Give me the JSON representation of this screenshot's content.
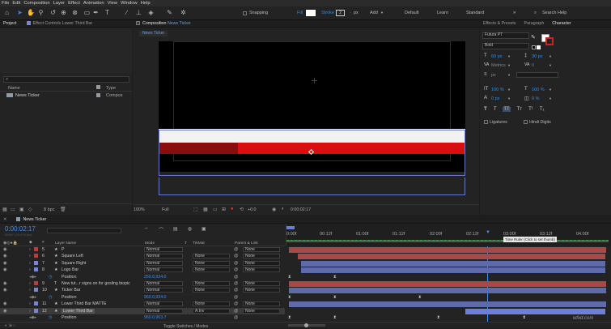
{
  "menu": [
    "File",
    "Edit",
    "Composition",
    "Layer",
    "Effect",
    "Animation",
    "View",
    "Window",
    "Help"
  ],
  "toolbar": {
    "snapping": "Snapping",
    "fill": "Fill",
    "stroke": "Stroke",
    "stroke_value": "2",
    "px": "px",
    "add": "Add",
    "workspaces": [
      "Default",
      "Learn",
      "Standard"
    ],
    "search_placeholder": "Search Help"
  },
  "project_panel": {
    "tab_project": "Project",
    "tab_effect_controls": "Effect Controls",
    "effect_controls_target": "Lower Third Bar",
    "search_glyph": "⌕",
    "col_name": "Name",
    "col_type": "Type",
    "items": [
      {
        "name": "News Ticker",
        "type": "Compos"
      }
    ],
    "bpc": "8 bpc"
  },
  "composition": {
    "tab": "Composition",
    "comp_name": "News Ticker",
    "sub_tab": "News Ticker",
    "zoom": "100%",
    "quality": "Full",
    "exposure": "+0.0",
    "timecode": "0:00:02:17"
  },
  "right_panel": {
    "tabs": [
      "Effects & Presets",
      "Paragraph",
      "Character"
    ],
    "font": "Futura PT",
    "style": "Bold",
    "size": "60 px",
    "leading": "30 px",
    "kerning": "Metrics",
    "tracking": "0",
    "vscale": "100 %",
    "hscale": "100 %",
    "baseline": "0 px",
    "tsume": "0 %",
    "unit": "px",
    "styles": [
      "T",
      "T",
      "TT",
      "Tт",
      "T¹",
      "T₁"
    ],
    "ligatures": "Ligatures",
    "hindi_digits": "Hindi Digits"
  },
  "timeline": {
    "tab": "News Ticker",
    "timecode": "0:00:02:17",
    "timecode_sub": "00067 (23.976 fps)",
    "columns": {
      "layer_name": "Layer Name",
      "mode": "Mode",
      "t": "T",
      "trkmat": "TrkMat",
      "parent": "Parent & Link"
    },
    "ruler": [
      "0:00f",
      "00:12f",
      "01:00f",
      "01:12f",
      "02:00f",
      "02:12f",
      "03:00f",
      "03:12f",
      "04:00f"
    ],
    "tooltip": "Time Ruler (Click to set thumb)",
    "toggle": "Toggle Switches / Modes",
    "layers": [
      {
        "num": "5",
        "name": "P",
        "mode": "Normal",
        "trkmat": "",
        "parent": "None",
        "color": "#c23a3a",
        "star": true
      },
      {
        "num": "6",
        "name": "Square Left",
        "mode": "Normal",
        "trkmat": "None",
        "parent": "None",
        "color": "#c23a3a",
        "star": true
      },
      {
        "num": "7",
        "name": "Square Right",
        "mode": "Normal",
        "trkmat": "None",
        "parent": "None",
        "color": "#7a86c8",
        "star": true
      },
      {
        "num": "8",
        "name": "Logo Bar",
        "mode": "Normal",
        "trkmat": "None",
        "parent": "None",
        "color": "#7a86c8",
        "star": true
      },
      {
        "num": "",
        "name": "Position",
        "value": "250.0,934.0",
        "prop": true
      },
      {
        "num": "9",
        "name": "New tut...r signs on for gosling biopic",
        "mode": "Normal",
        "trkmat": "None",
        "parent": "None",
        "color": "#c23a3a",
        "star": false
      },
      {
        "num": "10",
        "name": "Ticker Bar",
        "mode": "Normal",
        "trkmat": "None",
        "parent": "None",
        "color": "#7a86c8",
        "star": true
      },
      {
        "num": "",
        "name": "Position",
        "value": "960.0,934.0",
        "prop": true
      },
      {
        "num": "11",
        "name": "Lower Third Bar MATTE",
        "mode": "Normal",
        "trkmat": "None",
        "parent": "None",
        "color": "#7a86c8",
        "star": true
      },
      {
        "num": "12",
        "name": "Lower Third Bar",
        "mode": "Normal",
        "trkmat": "A.Inv",
        "parent": "None",
        "color": "#7a86c8",
        "star": true,
        "selected": true
      },
      {
        "num": "",
        "name": "Position",
        "value": "960.0,963.7",
        "prop": true
      }
    ]
  },
  "watermark": "wfxd.com"
}
